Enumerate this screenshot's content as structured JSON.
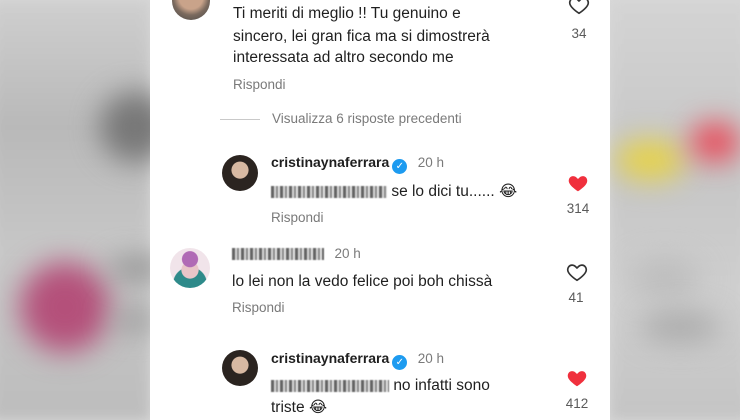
{
  "comments": {
    "top": {
      "text_line1": "Ti meriti di meglio !! Tu genuino e",
      "text_line2": "sincero, lei gran fica ma si dimostrerà",
      "text_line3": "interessata ad altro secondo me",
      "reply_label": "Rispondi",
      "like_count": "34"
    },
    "view_replies_label": "Visualizza 6 risposte precedenti",
    "reply1": {
      "username": "cristinaynaferrara",
      "time": "20 h",
      "text": "se lo dici tu...... 😂",
      "reply_label": "Rispondi",
      "like_count": "314"
    },
    "comment2": {
      "time": "20 h",
      "text": "lo lei non la vedo felice poi boh chissà",
      "reply_label": "Rispondi",
      "like_count": "41"
    },
    "reply2": {
      "username": "cristinaynaferrara",
      "time": "20 h",
      "text_line1": "no infatti sono",
      "text_line2": "triste 😂",
      "like_count": "412"
    }
  },
  "icons": {
    "heart_outline": "heart-outline-icon",
    "heart_filled": "heart-filled-icon",
    "verified": "verified-badge-icon"
  },
  "colors": {
    "liked_heart": "#f0303d",
    "verified_blue": "#1d9bf0",
    "secondary_text": "#7a7a7a"
  }
}
